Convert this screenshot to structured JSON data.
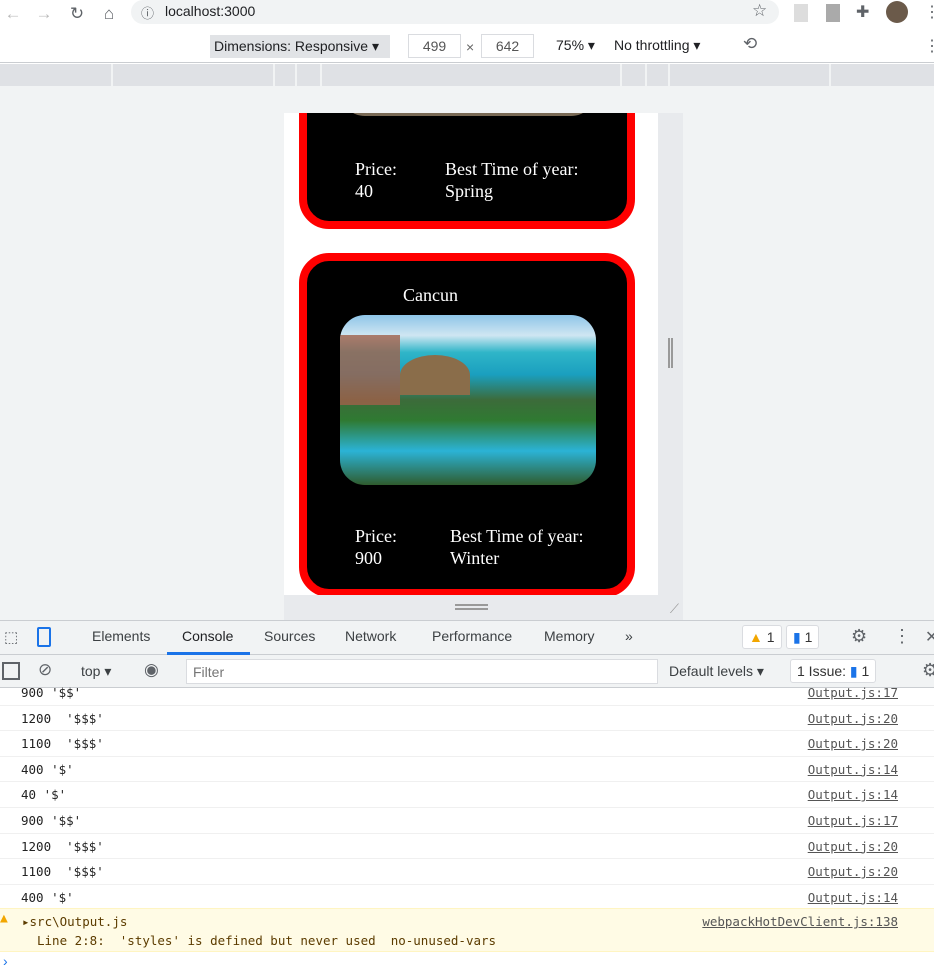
{
  "browser": {
    "url": "localhost:3000"
  },
  "device_toolbar": {
    "dimensions": "Dimensions: Responsive",
    "width": "499",
    "height": "642",
    "times": "×",
    "zoom": "75%",
    "throttling": "No throttling"
  },
  "cards": [
    {
      "price_label": "Price:",
      "price": "40",
      "time_label": "Best Time of year:",
      "time": "Spring"
    },
    {
      "title": "Cancun",
      "price_label": "Price:",
      "price": "900",
      "time_label": "Best Time of year:",
      "time": "Winter"
    }
  ],
  "devtools": {
    "tabs": [
      "Elements",
      "Console",
      "Sources",
      "Network",
      "Performance",
      "Memory"
    ],
    "warnings": "1",
    "messages": "1",
    "context": "top",
    "filter_placeholder": "Filter",
    "levels": "Default levels",
    "issues_label": "1 Issue:",
    "issues_count": "1"
  },
  "console": {
    "rows": [
      {
        "msg": "900 '$$'",
        "src": "Output.js:17"
      },
      {
        "msg": "1200  '$$$'",
        "src": "Output.js:20"
      },
      {
        "msg": "1100  '$$$'",
        "src": "Output.js:20"
      },
      {
        "msg": "400 '$'",
        "src": "Output.js:14"
      },
      {
        "msg": "40 '$'",
        "src": "Output.js:14"
      },
      {
        "msg": "900 '$$'",
        "src": "Output.js:17"
      },
      {
        "msg": "1200  '$$$'",
        "src": "Output.js:20"
      },
      {
        "msg": "1100  '$$$'",
        "src": "Output.js:20"
      },
      {
        "msg": "400 '$'",
        "src": "Output.js:14"
      }
    ],
    "warning": {
      "file": "src\\Output.js",
      "detail": "Line 2:8:  'styles' is defined but never used  no-unused-vars",
      "src": "webpackHotDevClient.js:138"
    }
  }
}
